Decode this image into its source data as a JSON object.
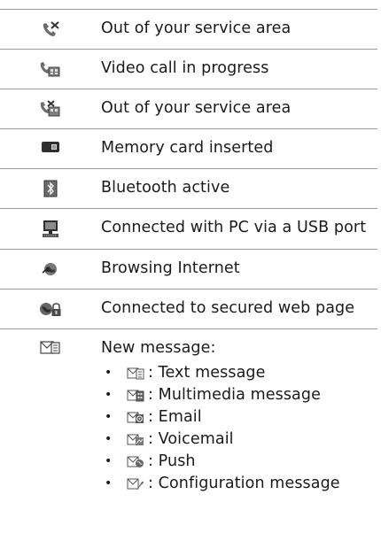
{
  "rows": [
    {
      "icon": "phone-crossed-icon",
      "label": "Out of your service area"
    },
    {
      "icon": "video-call-icon",
      "label": "Video call in progress"
    },
    {
      "icon": "video-call-crossed-icon",
      "label": "Out of your service area"
    },
    {
      "icon": "memory-card-icon",
      "label": "Memory card inserted"
    },
    {
      "icon": "bluetooth-icon",
      "label": "Bluetooth active"
    },
    {
      "icon": "pc-usb-icon",
      "label": "Connected with PC via a USB port"
    },
    {
      "icon": "globe-browsing-icon",
      "label": "Browsing Internet"
    },
    {
      "icon": "secure-lock-icon",
      "label": "Connected to secured web page"
    },
    {
      "icon": "new-message-icon",
      "label": "New message:"
    }
  ],
  "message_types": [
    {
      "icon": "text-message-icon",
      "label": ": Text message"
    },
    {
      "icon": "multimedia-message-icon",
      "label": ": Multimedia message"
    },
    {
      "icon": "email-icon",
      "label": ": Email"
    },
    {
      "icon": "voicemail-icon",
      "label": ": Voicemail"
    },
    {
      "icon": "push-message-icon",
      "label": ": Push"
    },
    {
      "icon": "configuration-message-icon",
      "label": ": Configuration message"
    }
  ]
}
